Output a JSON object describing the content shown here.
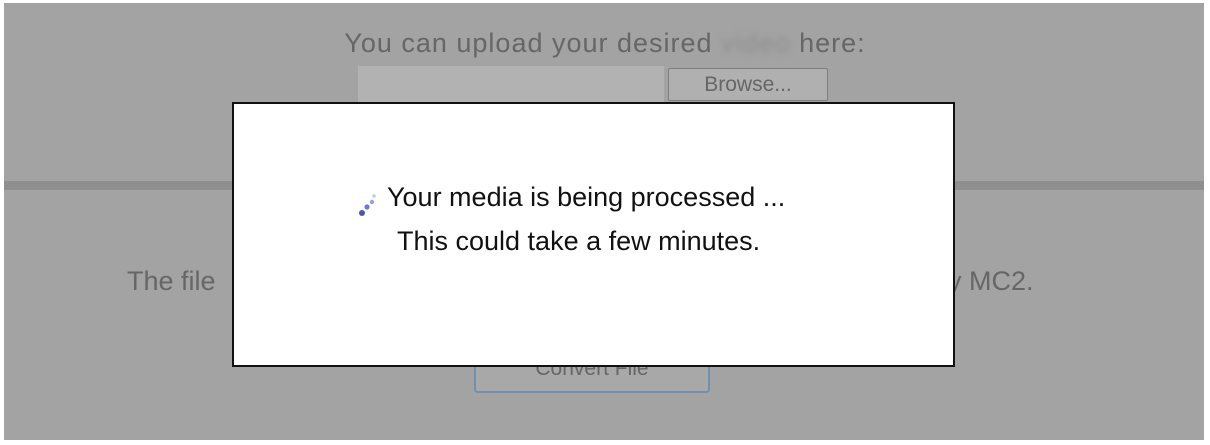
{
  "background": {
    "upload_prompt_before": "You can upload your desired",
    "upload_prompt_blurred": "video",
    "upload_prompt_after": "here:",
    "browse_label": "Browse...",
    "info_text_left": "The file",
    "info_text_right": "y MC2.",
    "convert_label": "Convert File"
  },
  "modal": {
    "spinner_icon": "loading-spinner-icon",
    "line1": "Your media is being processed ...",
    "line2": "This could take a few minutes."
  },
  "colors": {
    "overlay": "#a3a3a3",
    "modal_bg": "#ffffff",
    "modal_border": "#111111",
    "spinner_dots": "#4a55b8"
  }
}
